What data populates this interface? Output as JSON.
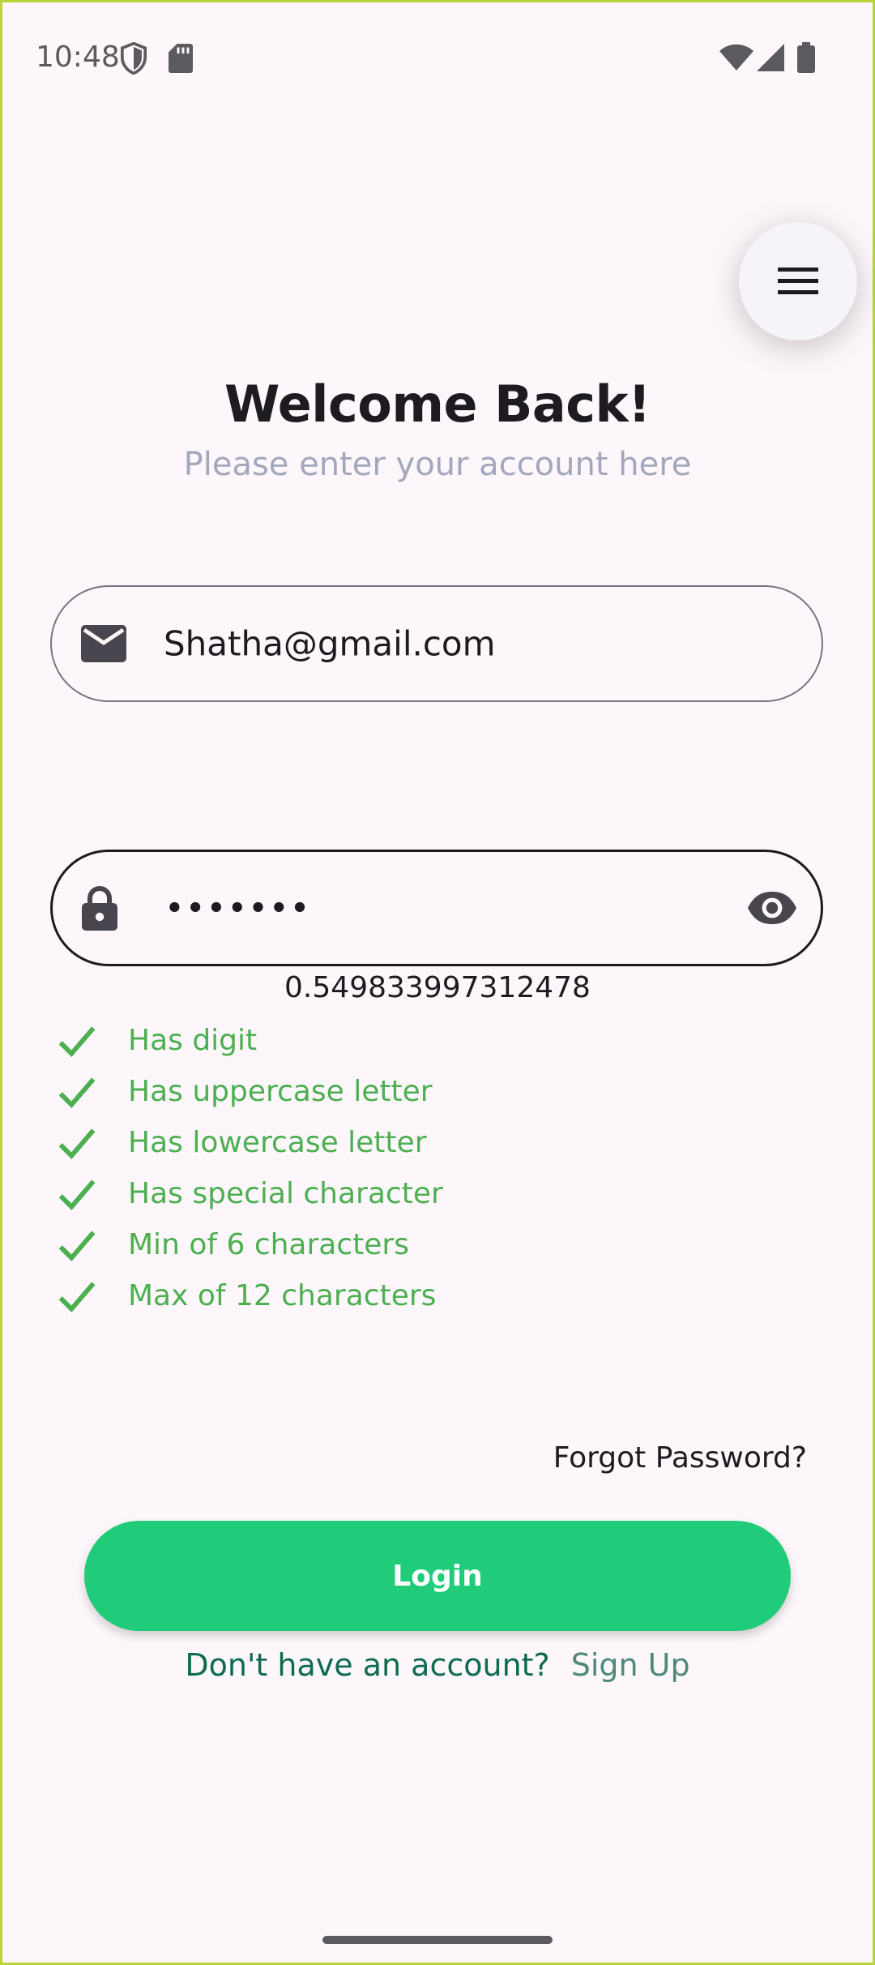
{
  "status_bar": {
    "time": "10:48",
    "icons": [
      "shield-icon",
      "sd-card-icon",
      "wifi-icon",
      "signal-icon",
      "battery-icon"
    ]
  },
  "header": {
    "menu_icon": "hamburger-menu-icon",
    "title": "Welcome Back!",
    "subtitle": "Please enter your account here"
  },
  "form": {
    "email": {
      "icon": "mail-icon",
      "value": "Shatha@gmail.com"
    },
    "password": {
      "icon": "lock-icon",
      "value": "•••••••",
      "toggle_icon": "eye-icon"
    },
    "random_value": "0.549833997312478",
    "rules": [
      {
        "label": "Has digit",
        "met": true
      },
      {
        "label": "Has uppercase letter",
        "met": true
      },
      {
        "label": "Has lowercase letter",
        "met": true
      },
      {
        "label": "Has special character",
        "met": true
      },
      {
        "label": "Min of 6 characters",
        "met": true
      },
      {
        "label": "Max of 12 characters",
        "met": true
      }
    ],
    "forgot_password": "Forgot Password?",
    "login_label": "Login",
    "signup_question": "Don't have an account?",
    "signup_link": "Sign Up"
  },
  "colors": {
    "background": "#fdf7fb",
    "primary_button": "#20cb7a",
    "rule_met": "#4caf50",
    "subtitle": "#a3a7bd",
    "signup_question": "#0d6b4e",
    "signup_link": "#4e8a78"
  }
}
